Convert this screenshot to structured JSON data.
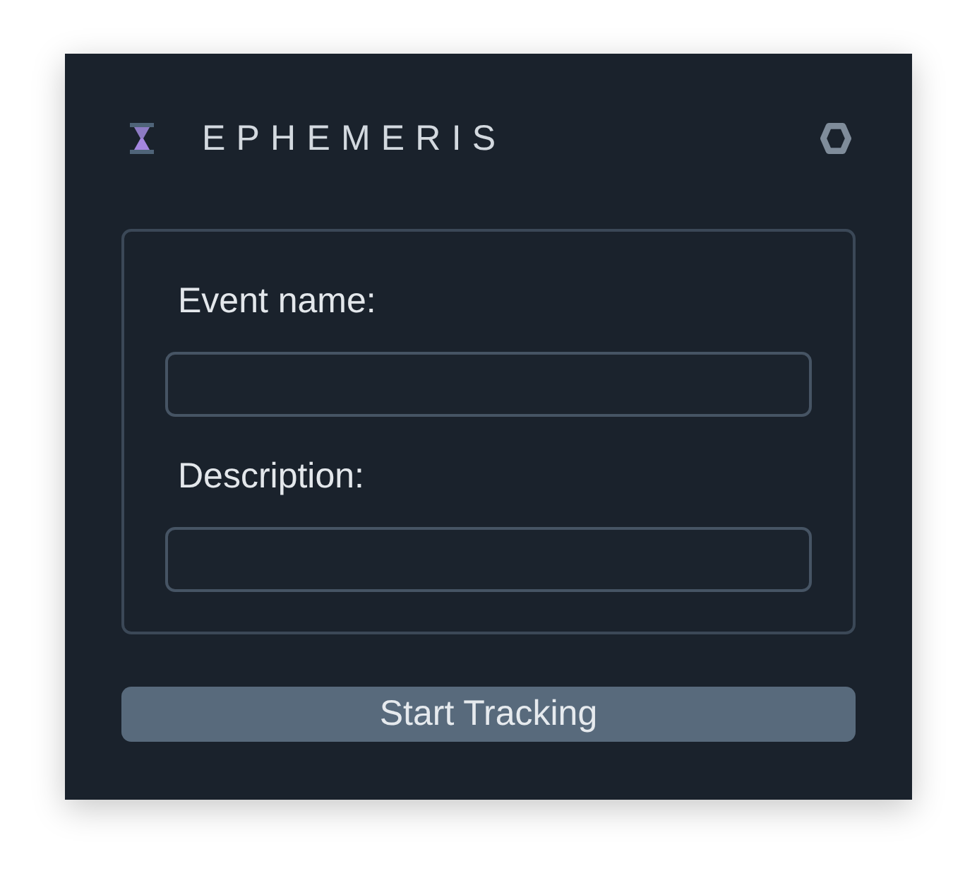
{
  "header": {
    "title": "EPHEMERIS"
  },
  "form": {
    "fields": [
      {
        "label": "Event name:"
      },
      {
        "label": "Description:"
      }
    ]
  },
  "button": {
    "label": "Start Tracking"
  }
}
